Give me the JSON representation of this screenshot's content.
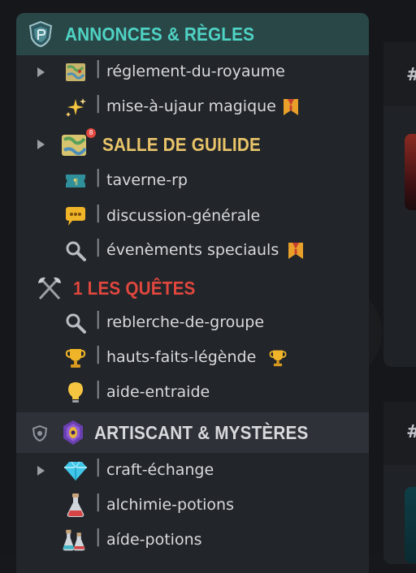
{
  "colors": {
    "sidebar_bg": "#222529",
    "category_announcements": "#4fd3c4",
    "category_guild": "#e9c46a",
    "category_quests": "#e0473e",
    "category_artisans": "#d7d9dc",
    "channel_text": "#d7d9dc"
  },
  "right_panel": {
    "hash_1": "#",
    "hash_2": "#"
  },
  "categories": [
    {
      "title": "ANNONCES & RÈGLES",
      "icon": "shield-icon"
    },
    {
      "title": "SALLE DE GUILIDE",
      "icon": "treasure-map-icon",
      "badge": "8"
    },
    {
      "title": "1 LES QUÊTES",
      "icon": "crossed-axes-icon"
    },
    {
      "title": "ARTISCANT & MYSTÈRES",
      "icon": "mystic-eye-icon"
    }
  ],
  "channels": [
    {
      "label": "réglement-du-royaume",
      "icon": "map-icon",
      "separator": "|"
    },
    {
      "label": "mise-à-ujaur magique",
      "icon": "sparkles-icon",
      "trailing": "banner-icon",
      "separator": "|"
    },
    {
      "label": "taverne-rp",
      "icon": "ticket-icon",
      "separator": "|"
    },
    {
      "label": "discussion-générale",
      "icon": "speech-bubble-icon",
      "separator": "|"
    },
    {
      "label": "évenèments speciauls",
      "icon": "magnifier-icon",
      "trailing": "banner-icon",
      "separator": "|"
    },
    {
      "label": "reblerche-de-groupe",
      "icon": "magnifier-icon",
      "separator": "|"
    },
    {
      "label": "hauts-faits-légènde",
      "icon": "trophy-icon",
      "trailing": "trophy-icon",
      "separator": "|"
    },
    {
      "label": "aide-entraide",
      "icon": "lightbulb-icon",
      "separator": "|"
    },
    {
      "label": "craft-échange",
      "icon": "diamond-icon",
      "separator": "|"
    },
    {
      "label": "alchimie-potions",
      "icon": "potion-icon",
      "separator": "|"
    },
    {
      "label": "aíde-potions",
      "icon": "potions-icon",
      "separator": "|"
    }
  ]
}
